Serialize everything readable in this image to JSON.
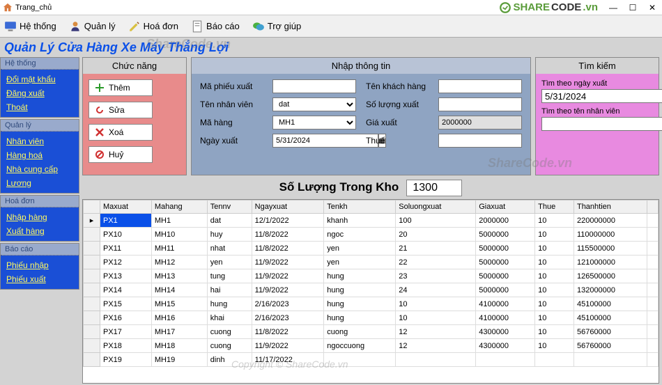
{
  "window": {
    "title": "Trang_chủ",
    "logo_share": "SHARE",
    "logo_code": "CODE",
    "logo_tld": ".vn"
  },
  "menubar": {
    "hethong": "Hệ thống",
    "quanly": "Quản lý",
    "hoadon": "Hoá đơn",
    "baocao": "Báo cáo",
    "trogiup": "Trợ giúp"
  },
  "app_title": "Quản Lý Cửa Hàng Xe Máy Thắng Lợi",
  "sidebar": {
    "g1": {
      "head": "Hệ thống",
      "items": [
        "Đổi mật khẩu",
        "Đăng xuất",
        "Thoát"
      ]
    },
    "g2": {
      "head": "Quản lý",
      "items": [
        "Nhân viên",
        "Hàng hoá",
        "Nhà cung cấp",
        "Lương"
      ]
    },
    "g3": {
      "head": "Hoá đơn",
      "items": [
        "Nhập hàng",
        "Xuất hàng"
      ]
    },
    "g4": {
      "head": "Báo cáo",
      "items": [
        "Phiếu nhập",
        "Phiếu xuất"
      ]
    }
  },
  "panel_func": {
    "head": "Chức năng",
    "them": "Thêm",
    "sua": "Sửa",
    "xoa": "Xoá",
    "huy": "Huỷ"
  },
  "panel_info": {
    "head": "Nhập thông tin",
    "lbl_maphieu": "Mã phiếu xuất",
    "val_maphieu": "",
    "lbl_tennv": "Tên nhân viên",
    "val_tennv": "dat",
    "lbl_mahang": "Mã hàng",
    "val_mahang": "MH1",
    "lbl_ngayxuat": "Ngày xuất",
    "val_ngayxuat": "5/31/2024",
    "lbl_tenkh": "Tên khách hàng",
    "val_tenkh": "",
    "lbl_slxuat": "Số lượng xuất",
    "val_slxuat": "",
    "lbl_giaxuat": "Giá xuất",
    "val_giaxuat": "2000000",
    "lbl_thue": "Thuế",
    "val_thue": ""
  },
  "panel_search": {
    "head": "Tìm kiếm",
    "lbl_date": "Tìm theo ngày xuất",
    "val_date": "5/31/2024",
    "lbl_nv": "Tìm theo tên nhân viên",
    "val_nv": ""
  },
  "stock": {
    "label": "Số Lượng Trong Kho",
    "value": "1300"
  },
  "table": {
    "headers": [
      "Maxuat",
      "Mahang",
      "Tennv",
      "Ngayxuat",
      "Tenkh",
      "Soluongxuat",
      "Giaxuat",
      "Thue",
      "Thanhtien"
    ],
    "rows": [
      [
        "PX1",
        "MH1",
        "dat",
        "12/1/2022",
        "khanh",
        "100",
        "2000000",
        "10",
        "220000000"
      ],
      [
        "PX10",
        "MH10",
        "huy",
        "11/8/2022",
        "ngoc",
        "20",
        "5000000",
        "10",
        "110000000"
      ],
      [
        "PX11",
        "MH11",
        "nhat",
        "11/8/2022",
        "yen",
        "21",
        "5000000",
        "10",
        "115500000"
      ],
      [
        "PX12",
        "MH12",
        "yen",
        "11/9/2022",
        "yen",
        "22",
        "5000000",
        "10",
        "121000000"
      ],
      [
        "PX13",
        "MH13",
        "tung",
        "11/9/2022",
        "hung",
        "23",
        "5000000",
        "10",
        "126500000"
      ],
      [
        "PX14",
        "MH14",
        "hai",
        "11/9/2022",
        "hung",
        "24",
        "5000000",
        "10",
        "132000000"
      ],
      [
        "PX15",
        "MH15",
        "hung",
        "2/16/2023",
        "hung",
        "10",
        "4100000",
        "10",
        "45100000"
      ],
      [
        "PX16",
        "MH16",
        "khai",
        "2/16/2023",
        "hung",
        "10",
        "4100000",
        "10",
        "45100000"
      ],
      [
        "PX17",
        "MH17",
        "cuong",
        "11/8/2022",
        "cuong",
        "12",
        "4300000",
        "10",
        "56760000"
      ],
      [
        "PX18",
        "MH18",
        "cuong",
        "11/9/2022",
        "ngoccuong",
        "12",
        "4300000",
        "10",
        "56760000"
      ],
      [
        "PX19",
        "MH19",
        "dinh",
        "11/17/2022",
        "",
        "",
        "",
        "",
        ""
      ]
    ]
  },
  "watermark": {
    "a": "ShareCode.vn",
    "b": "ShareCode.vn",
    "c": "Copyright © ShareCode.vn"
  }
}
